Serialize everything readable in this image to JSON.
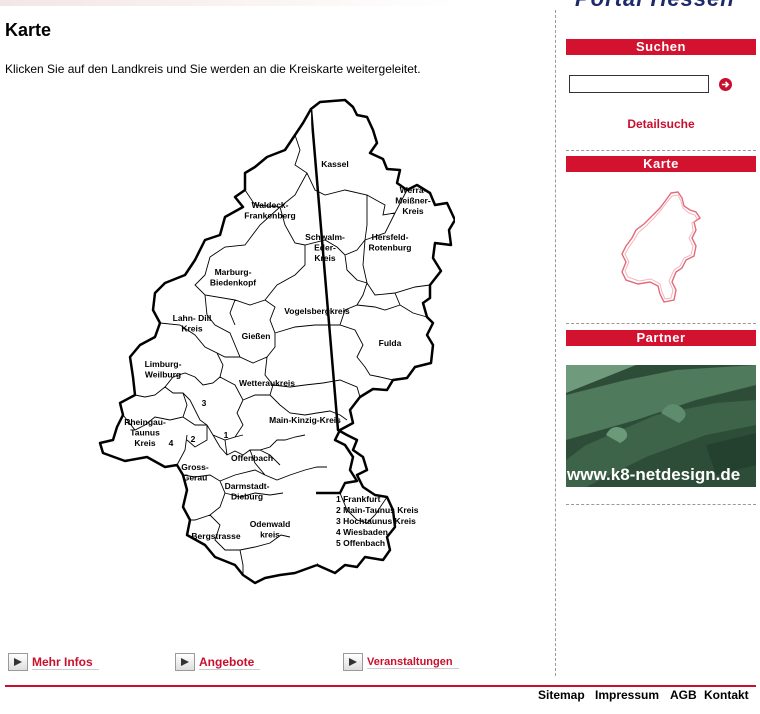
{
  "header": {
    "logo_fragment": "Portal Hessen"
  },
  "main": {
    "title": "Karte",
    "intro": "Klicken Sie auf den Landkreis und Sie werden an die Kreiskarte weitergeleitet.",
    "districts": [
      {
        "id": "kassel",
        "lines": [
          "Kassel"
        ]
      },
      {
        "id": "werra",
        "lines": [
          "Werra-",
          "Meißner-",
          "Kreis"
        ]
      },
      {
        "id": "waldeck",
        "lines": [
          "Waldeck-",
          "Frankenberg"
        ]
      },
      {
        "id": "schwalm",
        "lines": [
          "Schwalm-",
          "Eder-",
          "Kreis"
        ]
      },
      {
        "id": "hersfeld",
        "lines": [
          "Hersfeld-",
          "Rotenburg"
        ]
      },
      {
        "id": "marburg",
        "lines": [
          "Marburg-",
          "Biedenkopf"
        ]
      },
      {
        "id": "vogelsberg",
        "lines": [
          "Vogelsbergkreis"
        ]
      },
      {
        "id": "lahndill",
        "lines": [
          "Lahn- Dill",
          "Kreis"
        ]
      },
      {
        "id": "giessen",
        "lines": [
          "Gießen"
        ]
      },
      {
        "id": "fulda",
        "lines": [
          "Fulda"
        ]
      },
      {
        "id": "limburg",
        "lines": [
          "Limburg-",
          "Weilburg"
        ]
      },
      {
        "id": "wetterau",
        "lines": [
          "Wetteraukreis"
        ]
      },
      {
        "id": "num3",
        "lines": [
          "3"
        ]
      },
      {
        "id": "rheingau",
        "lines": [
          "Rheingau-",
          "Taunus",
          "Kreis"
        ]
      },
      {
        "id": "num4",
        "lines": [
          "4"
        ]
      },
      {
        "id": "num2",
        "lines": [
          "2"
        ]
      },
      {
        "id": "num1",
        "lines": [
          "1"
        ]
      },
      {
        "id": "mainkinzig",
        "lines": [
          "Main-Kinzig-Kreis"
        ]
      },
      {
        "id": "offenbach",
        "lines": [
          "Offenbach"
        ]
      },
      {
        "id": "grossgerau",
        "lines": [
          "Gross-",
          "Gerau"
        ]
      },
      {
        "id": "darmstadt",
        "lines": [
          "Darmstadt-",
          "Dieburg"
        ]
      },
      {
        "id": "odenwald",
        "lines": [
          "Odenwald",
          "kreis"
        ]
      },
      {
        "id": "bergstrasse",
        "lines": [
          "Bergstrasse"
        ]
      }
    ],
    "legend": [
      "1 Frankfurt",
      "2 Main-Taunus Kreis",
      "3 Hochtaunus Kreis",
      "4 Wiesbaden",
      "5 Offenbach"
    ],
    "bottom_links": [
      "Mehr Infos",
      "Angebote",
      "Veranstaltungen"
    ]
  },
  "sidebar": {
    "search": {
      "heading": "Suchen",
      "value": "",
      "placeholder": "",
      "detail_link": "Detailsuche"
    },
    "map_heading": "Karte",
    "partner_heading": "Partner",
    "partner_banner": "www.k8-netdesign.de"
  },
  "footer": {
    "links": [
      "Sitemap",
      "Impressum",
      "AGB",
      "Kontakt"
    ]
  },
  "colors": {
    "accent": "#d3122f",
    "link": "#c8102e"
  }
}
